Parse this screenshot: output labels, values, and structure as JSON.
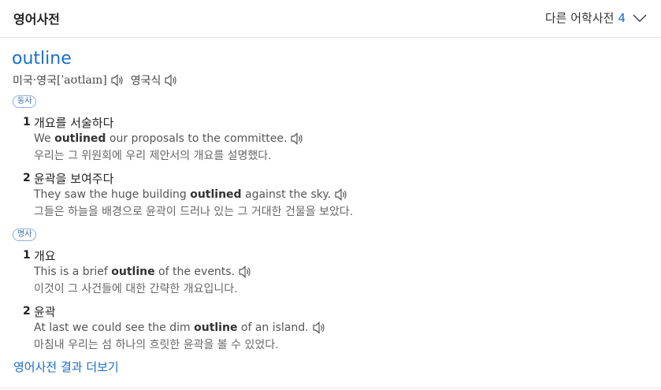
{
  "header": {
    "title": "영어사전",
    "other_label": "다른 어학사전",
    "other_count": "4"
  },
  "entry": {
    "word": "outline",
    "pron": {
      "us_label": "미국",
      "sep": "·",
      "uk_label": "영국",
      "ipa": "[ˈaʊtlaɪn]",
      "uk_style_label": "영국식"
    }
  },
  "pos_groups": [
    {
      "pos": "동사",
      "senses": [
        {
          "num": "1",
          "meaning": "개요를 서술하다",
          "ex_pre": "We ",
          "ex_bold": "outlined",
          "ex_post": " our proposals to the committee.",
          "translation": "우리는 그 위원회에 우리 제안서의 개요를 설명했다."
        },
        {
          "num": "2",
          "meaning": "윤곽을 보여주다",
          "ex_pre": "They saw the huge building ",
          "ex_bold": "outlined",
          "ex_post": " against the sky.",
          "translation": "그들은 하늘을 배경으로 윤곽이 드러나 있는 그 거대한 건물을 보았다."
        }
      ]
    },
    {
      "pos": "명사",
      "senses": [
        {
          "num": "1",
          "meaning": "개요",
          "ex_pre": "This is a brief ",
          "ex_bold": "outline",
          "ex_post": " of the events.",
          "translation": "이것이 그 사건들에 대한 간략한 개요입니다."
        },
        {
          "num": "2",
          "meaning": "윤곽",
          "ex_pre": "At last we could see the dim ",
          "ex_bold": "outline",
          "ex_post": " of an island.",
          "translation": "마침내 우리는 섬 하나의 흐릿한 윤곽을 볼 수 있었다."
        }
      ]
    }
  ],
  "more_link": "영어사전 결과 더보기",
  "icons": {
    "speaker": "speaker-icon",
    "chevron": "chevron-down-icon"
  },
  "colors": {
    "accent": "#1a6ec8"
  }
}
